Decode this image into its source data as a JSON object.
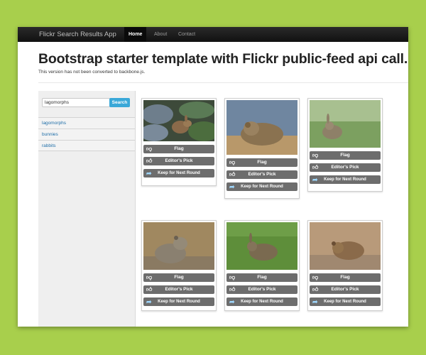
{
  "navbar": {
    "brand": "Flickr Search Results App",
    "items": [
      {
        "label": "Home",
        "active": true
      },
      {
        "label": "About",
        "active": false
      },
      {
        "label": "Contact",
        "active": false
      }
    ]
  },
  "header": {
    "title": "Bootstrap starter template with Flickr public-feed api call.",
    "subtitle": "This version has not been converted to backbone.js."
  },
  "sidebar": {
    "search_value": "lagomorphs",
    "search_button": "Search",
    "links": [
      "lagomorphs",
      "bunnies",
      "rabbits"
    ]
  },
  "card_buttons": {
    "flag": "Flag",
    "editors_pick": "Editor's Pick",
    "keep": "Keep for Next Round"
  },
  "icons": {
    "flag": "thumbs-down-icon",
    "editors_pick": "thumbs-up-icon",
    "keep": "curved-arrow-icon"
  },
  "photos": [
    {
      "subject": "rabbit-in-moss"
    },
    {
      "subject": "pika-on-rock"
    },
    {
      "subject": "rabbit-in-grass"
    },
    {
      "subject": "pika-on-rock-2"
    },
    {
      "subject": "rabbit-on-lawn"
    },
    {
      "subject": "pika-on-boulder"
    }
  ]
}
